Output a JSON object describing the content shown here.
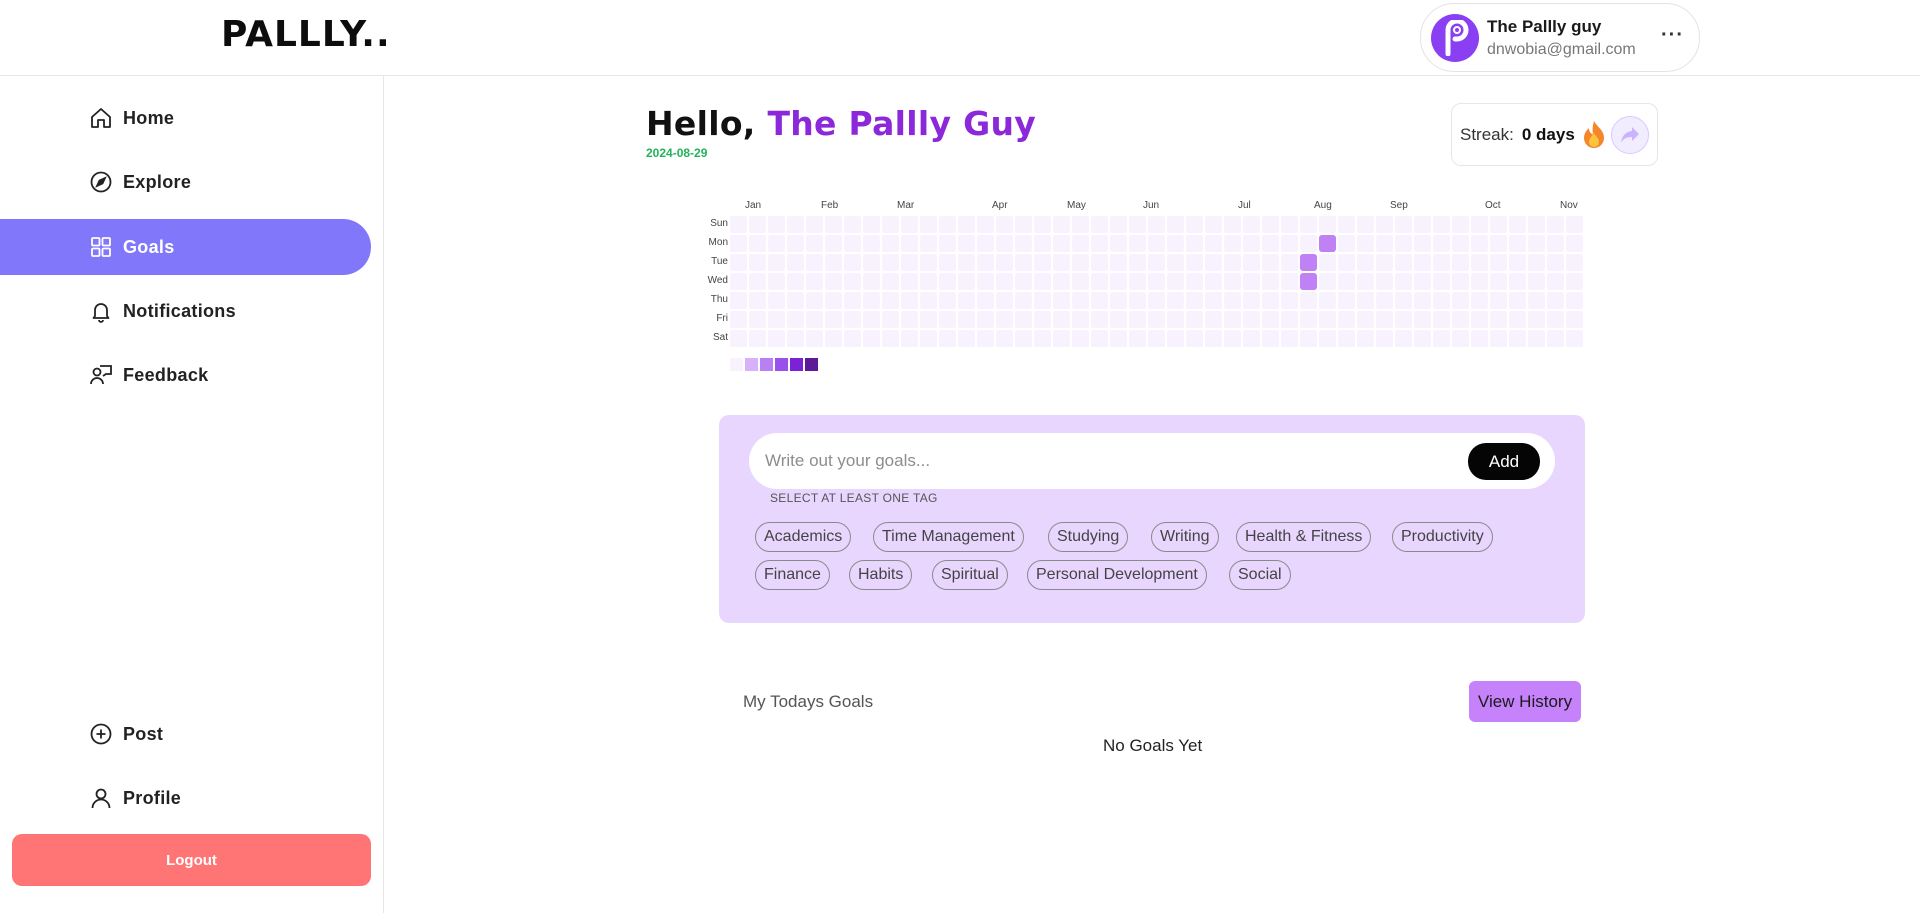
{
  "header": {
    "logo": "PALLLY..",
    "user": {
      "name": "The Pallly guy",
      "email": "dnwobia@gmail.com",
      "more": "···",
      "avatar_icon": "pallly-logo-icon"
    }
  },
  "sidebar": {
    "items": [
      {
        "label": "Home",
        "icon": "home-icon"
      },
      {
        "label": "Explore",
        "icon": "compass-icon"
      },
      {
        "label": "Goals",
        "icon": "grid-icon",
        "active": true
      },
      {
        "label": "Notifications",
        "icon": "bell-icon"
      },
      {
        "label": "Feedback",
        "icon": "feedback-icon"
      }
    ],
    "bottom_items": [
      {
        "label": "Post",
        "icon": "plus-circle-icon"
      },
      {
        "label": "Profile",
        "icon": "user-icon"
      }
    ],
    "logout": "Logout",
    "active_color": "#8077fb",
    "logout_color": "#ff7575"
  },
  "greeting": {
    "hello": "Hello,",
    "name": "The Pallly Guy",
    "date": "2024-08-29"
  },
  "streak": {
    "label": "Streak:",
    "value": "0 days"
  },
  "heatmap": {
    "months": [
      "Jan",
      "Feb",
      "Mar",
      "Apr",
      "May",
      "Jun",
      "Jul",
      "Aug",
      "Sep",
      "Oct",
      "Nov"
    ],
    "days": [
      "Sun",
      "Mon",
      "Tue",
      "Wed",
      "Thu",
      "Fri",
      "Sat"
    ],
    "active_cells": [
      {
        "week": 30,
        "day": 2
      },
      {
        "week": 30,
        "day": 3
      },
      {
        "week": 31,
        "day": 1
      }
    ],
    "legend_colors": [
      "#f8f2fe",
      "#d7b1fa",
      "#b980f4",
      "#9b50eb",
      "#7c22d6",
      "#5c1a96"
    ]
  },
  "goals_form": {
    "placeholder": "Write out your goals...",
    "add_label": "Add",
    "tag_hint": "SELECT AT LEAST ONE TAG",
    "tags": [
      "Academics",
      "Time Management",
      "Studying",
      "Writing",
      "Health & Fitness",
      "Productivity",
      "Finance",
      "Habits",
      "Spiritual",
      "Personal Development",
      "Social"
    ]
  },
  "todays_goals": {
    "title": "My Todays Goals",
    "history_label": "View History",
    "empty_text": "No Goals Yet"
  }
}
